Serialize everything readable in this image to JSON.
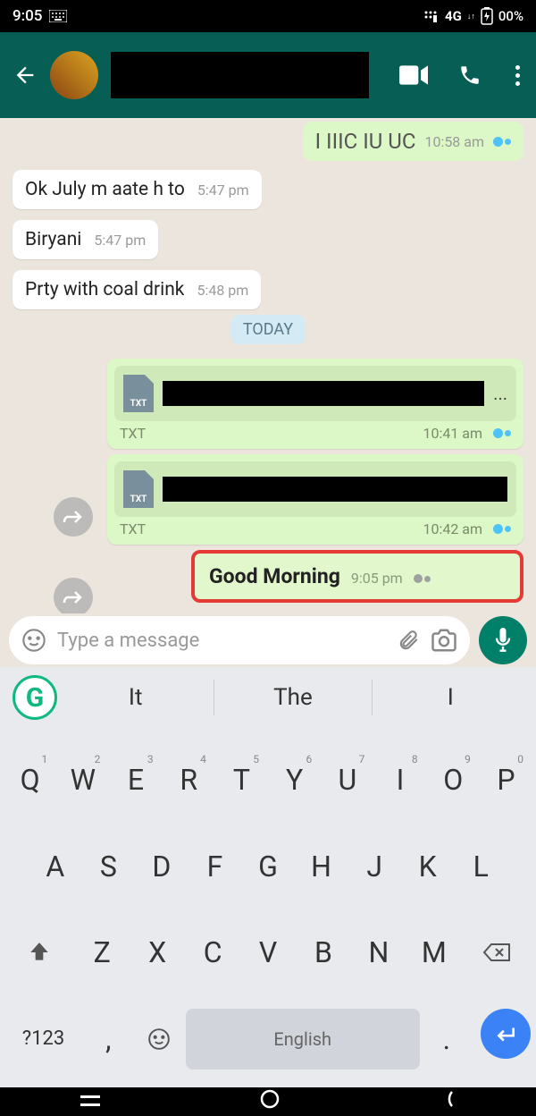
{
  "status": {
    "time": "9:05",
    "network": "4G",
    "net_arrow": "↓↑",
    "battery": "00%"
  },
  "header": {
    "video_icon": "video-icon",
    "call_icon": "call-icon",
    "more_icon": "more-icon"
  },
  "chat": {
    "partial_out": {
      "text": "I IIIC IU UC",
      "time": "10:58 am"
    },
    "in": [
      {
        "text": "Ok July m aate h to",
        "time": "5:47 pm"
      },
      {
        "text": "Biryani",
        "time": "5:47 pm"
      },
      {
        "text": "Prty with coal drink",
        "time": "5:48 pm"
      }
    ],
    "date": "TODAY",
    "files": [
      {
        "type": "TXT",
        "time": "10:41 am"
      },
      {
        "type": "TXT",
        "time": "10:42 am"
      }
    ],
    "highlight": {
      "text": "Good Morning",
      "time": "9:05 pm"
    }
  },
  "input": {
    "placeholder": "Type a message"
  },
  "keyboard": {
    "suggestions": [
      "It",
      "The",
      "I"
    ],
    "row1": [
      "Q",
      "W",
      "E",
      "R",
      "T",
      "Y",
      "U",
      "I",
      "O",
      "P"
    ],
    "nums": [
      "1",
      "2",
      "3",
      "4",
      "5",
      "6",
      "7",
      "8",
      "9",
      "0"
    ],
    "row2": [
      "A",
      "S",
      "D",
      "F",
      "G",
      "H",
      "J",
      "K",
      "L"
    ],
    "row3": [
      "Z",
      "X",
      "C",
      "V",
      "B",
      "N",
      "M"
    ],
    "sym": "?123",
    "comma": ",",
    "period": ".",
    "lang": "English"
  }
}
